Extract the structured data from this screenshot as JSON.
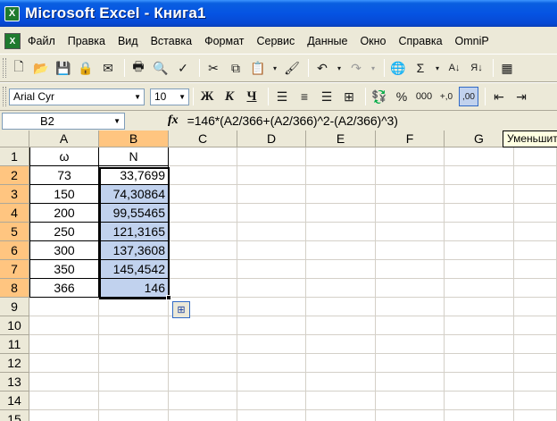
{
  "window": {
    "title": "Microsoft Excel - Книга1",
    "app_icon": "X"
  },
  "menu": [
    "Файл",
    "Правка",
    "Вид",
    "Вставка",
    "Формат",
    "Сервис",
    "Данные",
    "Окно",
    "Справка",
    "OmniP"
  ],
  "toolbar_format": {
    "font_name": "Arial Cyr",
    "font_size": "10",
    "bold": "Ж",
    "italic": "К",
    "underline": "Ч",
    "percent": "%",
    "thousands": "000"
  },
  "formula_bar": {
    "name_box": "B2",
    "fx_label": "fx",
    "formula": "=146*(A2/366+(A2/366)^2-(A2/366)^3)"
  },
  "tooltip": "Уменьшит",
  "columns": [
    "A",
    "B",
    "C",
    "D",
    "E",
    "F",
    "G"
  ],
  "rows": [
    {
      "num": "1",
      "a": "ω",
      "b": "N"
    },
    {
      "num": "2",
      "a": "73",
      "b": "33,7699"
    },
    {
      "num": "3",
      "a": "150",
      "b": "74,30864"
    },
    {
      "num": "4",
      "a": "200",
      "b": "99,55465"
    },
    {
      "num": "5",
      "a": "250",
      "b": "121,3165"
    },
    {
      "num": "6",
      "a": "300",
      "b": "137,3608"
    },
    {
      "num": "7",
      "a": "350",
      "b": "145,4542"
    },
    {
      "num": "8",
      "a": "366",
      "b": "146"
    },
    {
      "num": "9",
      "a": "",
      "b": ""
    },
    {
      "num": "10",
      "a": "",
      "b": ""
    },
    {
      "num": "11",
      "a": "",
      "b": ""
    },
    {
      "num": "12",
      "a": "",
      "b": ""
    },
    {
      "num": "13",
      "a": "",
      "b": ""
    },
    {
      "num": "14",
      "a": "",
      "b": ""
    },
    {
      "num": "15",
      "a": "",
      "b": ""
    }
  ],
  "colors": {
    "titlebar": "#0554e3",
    "selection": "#c1d2ee",
    "header_selected": "#ffc580"
  }
}
